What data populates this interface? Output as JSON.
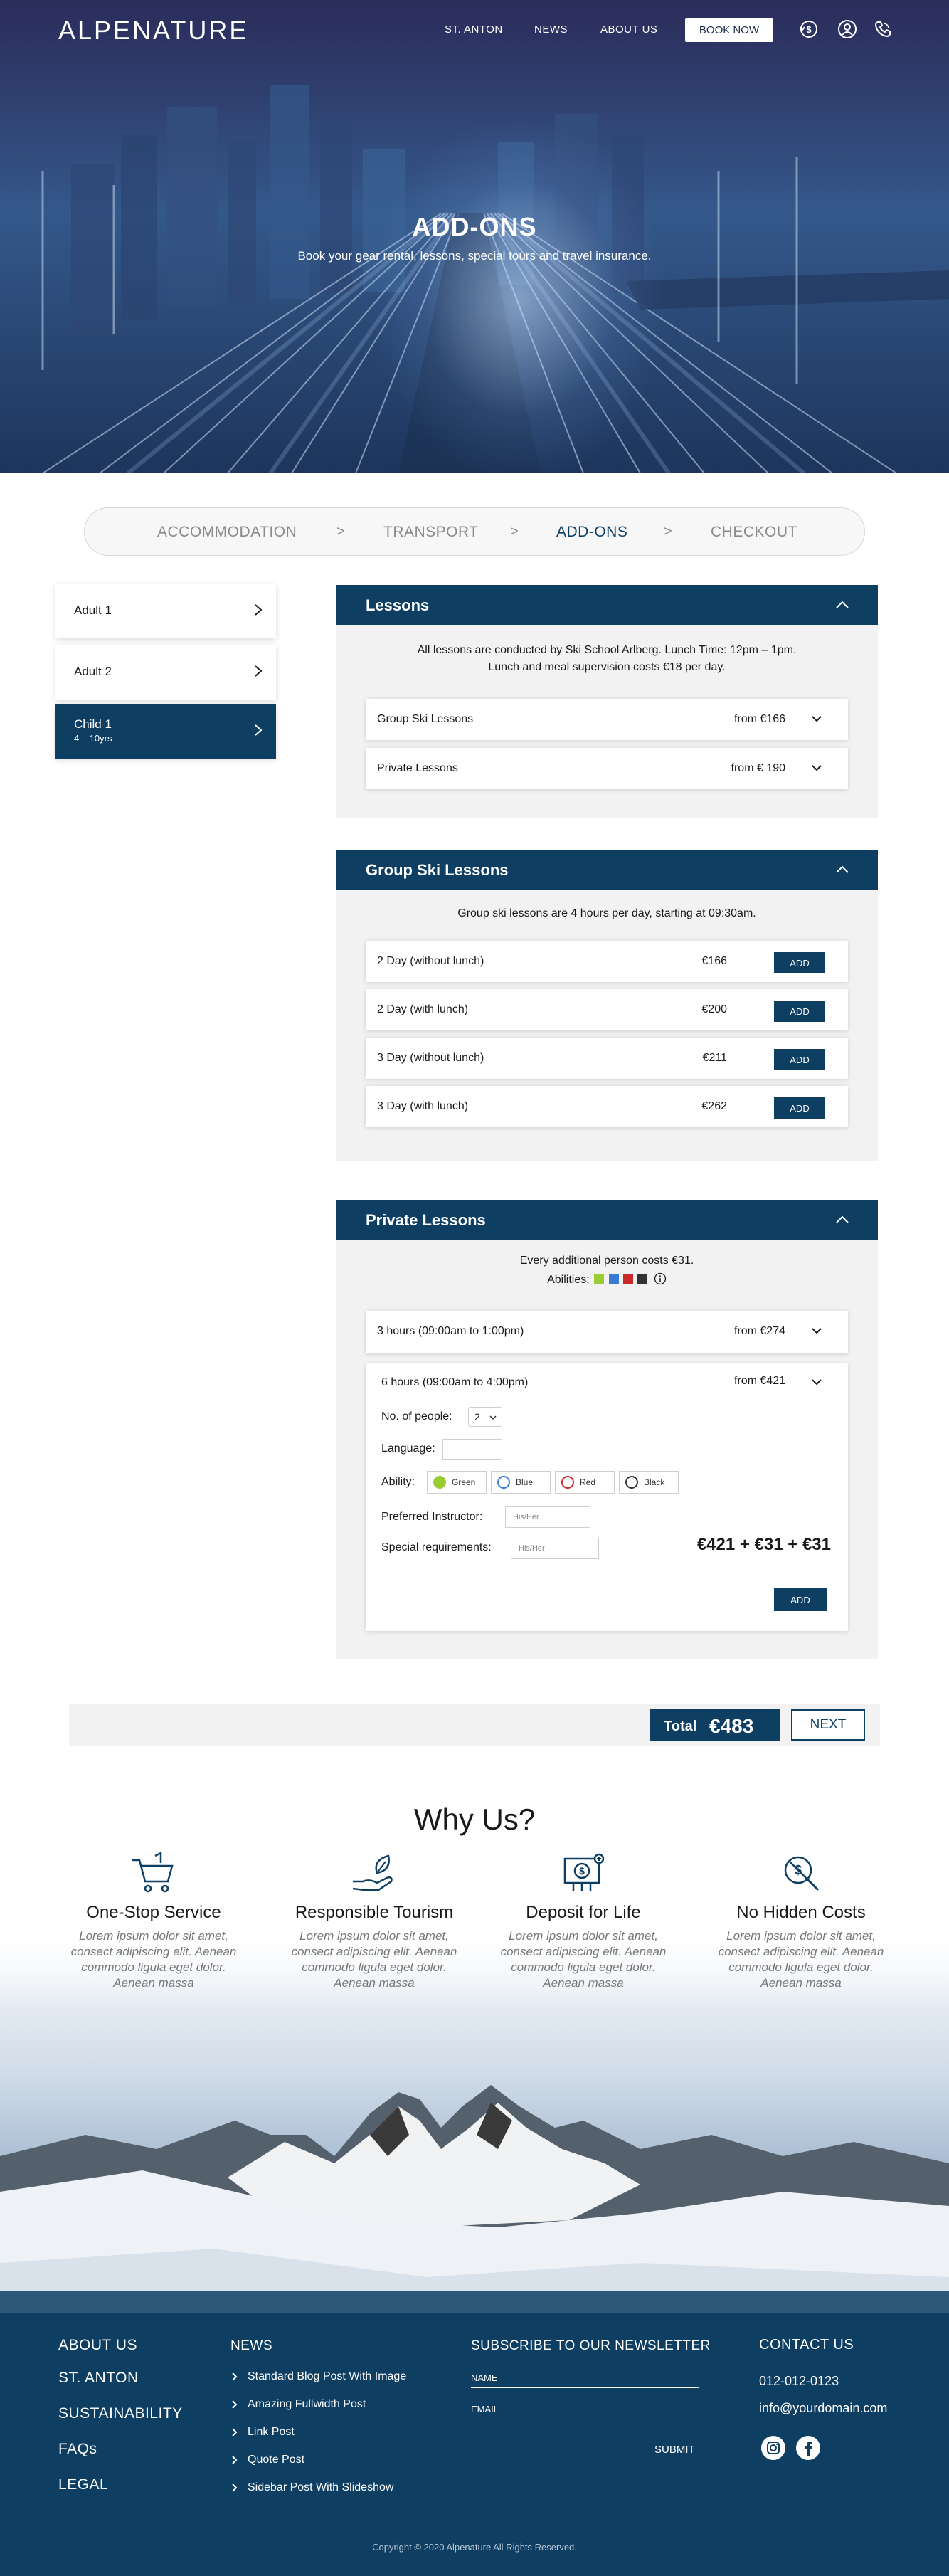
{
  "nav": {
    "logo": "ALPENATURE",
    "links": [
      "ST. ANTON",
      "NEWS",
      "ABOUT US"
    ],
    "book_now": "BOOK NOW",
    "icons": [
      "currency-exchange-icon",
      "user-icon",
      "phone-icon"
    ]
  },
  "hero": {
    "title": "ADD-ONS",
    "subtitle": "Book your gear rental, lessons, special tours and travel insurance."
  },
  "steps": {
    "items": [
      "ACCOMMODATION",
      "TRANSPORT",
      "ADD-ONS",
      "CHECKOUT"
    ],
    "separator": ">",
    "active": "ADD-ONS"
  },
  "sidebar": {
    "items": [
      {
        "label": "Adult 1",
        "sub": ""
      },
      {
        "label": "Adult 2",
        "sub": ""
      },
      {
        "label": "Child 1",
        "sub": "4 – 10yrs"
      }
    ]
  },
  "lessons": {
    "title": "Lessons",
    "note_line1": "All lessons are conducted by Ski School Arlberg. Lunch Time: 12pm – 1pm.",
    "note_line2": "Lunch and meal supervision costs €18 per day.",
    "rows": [
      {
        "name": "Group Ski Lessons",
        "price": "from €166"
      },
      {
        "name": "Private Lessons",
        "price": "from € 190"
      }
    ]
  },
  "group": {
    "title": "Group Ski Lessons",
    "note": "Group ski lessons are 4 hours per day, starting at 09:30am.",
    "add_label": "ADD",
    "rows": [
      {
        "name": "2 Day (without lunch)",
        "price": "€166"
      },
      {
        "name": "2 Day (with lunch)",
        "price": "€200"
      },
      {
        "name": "3 Day (without lunch)",
        "price": "€211"
      },
      {
        "name": "3 Day (with lunch)",
        "price": "€262"
      }
    ]
  },
  "private": {
    "title": "Private Lessons",
    "note": "Every additional person costs €31.",
    "abilities_label": "Abilities:",
    "ability_colors": [
      "#9acd32",
      "#3a7bd5",
      "#cc2a2a",
      "#333333"
    ],
    "rows": [
      {
        "name": "3 hours (09:00am to 1:00pm)",
        "price": "from €274"
      },
      {
        "name": "6 hours (09:00am to 4:00pm)",
        "price": "from €421"
      }
    ],
    "form": {
      "people_label": "No. of people:",
      "people_value": "2",
      "language_label": "Language:",
      "language_value": "",
      "ability_label": "Ability:",
      "ability_options": [
        {
          "name": "Green",
          "color": "#9acd32",
          "filled": true
        },
        {
          "name": "Blue",
          "color": "#3a7bd5",
          "filled": false
        },
        {
          "name": "Red",
          "color": "#cc2a2a",
          "filled": false
        },
        {
          "name": "Black",
          "color": "#333333",
          "filled": false
        }
      ],
      "instructor_label": "Preferred Instructor:",
      "instructor_placeholder": "His/Her",
      "requirements_label": "Special requirements:",
      "requirements_placeholder": "His/Her",
      "price_summary": "€421 + €31 + €31",
      "add_label": "ADD"
    }
  },
  "total": {
    "label": "Total",
    "value": "€483",
    "next": "NEXT"
  },
  "why": {
    "title": "Why Us?",
    "items": [
      {
        "icon": "shopping-cart-icon",
        "heading": "One-Stop Service",
        "text": "Lorem ipsum dolor sit amet, consect adipiscing elit. Aenean commodo ligula eget dolor. Aenean massa"
      },
      {
        "icon": "leaf-hand-icon",
        "heading": "Responsible Tourism",
        "text": "Lorem ipsum dolor sit amet, consect adipiscing elit. Aenean commodo ligula eget dolor. Aenean massa"
      },
      {
        "icon": "money-deposit-icon",
        "heading": "Deposit for Life",
        "text": "Lorem ipsum dolor sit amet, consect adipiscing elit. Aenean commodo ligula eget dolor. Aenean massa"
      },
      {
        "icon": "no-hidden-costs-icon",
        "heading": "No Hidden Costs",
        "text": "Lorem ipsum dolor sit amet, consect adipiscing elit. Aenean commodo ligula eget dolor. Aenean massa"
      }
    ]
  },
  "footer": {
    "col1": [
      "ABOUT US",
      "ST. ANTON",
      "SUSTAINABILITY",
      "FAQs",
      "LEGAL"
    ],
    "news_title": "NEWS",
    "news_links": [
      "Standard Blog Post With Image",
      "Amazing Fullwidth Post",
      "Link Post",
      "Quote Post",
      "Sidebar Post With Slideshow"
    ],
    "newsletter_title": "SUBSCRIBE TO OUR NEWSLETTER",
    "name_field": "NAME",
    "email_field": "EMAIL",
    "submit": "SUBMIT",
    "contact_title": "CONTACT US",
    "phone": "012-012-0123",
    "email": "info@yourdomain.com",
    "social": [
      "instagram-icon",
      "facebook-icon"
    ],
    "copyright": "Copyright © 2020  Alpenature  All Rights Reserved."
  },
  "colors": {
    "primary": "#0e3f63",
    "panel_bg": "#f2f2f2",
    "muted": "#8a8a8a"
  }
}
